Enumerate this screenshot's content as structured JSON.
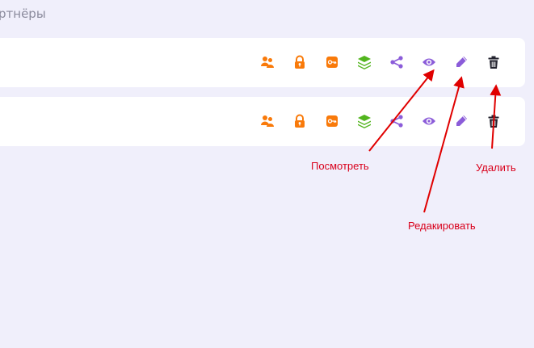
{
  "page": {
    "heading": "ртнёры"
  },
  "rows": [
    {
      "actions": [
        {
          "icon": "users-icon",
          "color": "#f97a0a"
        },
        {
          "icon": "lock-icon",
          "color": "#f97a0a"
        },
        {
          "icon": "key-icon",
          "color": "#f97a0a"
        },
        {
          "icon": "layers-icon",
          "color": "#52b51e"
        },
        {
          "icon": "share-icon",
          "color": "#8b5cd9"
        },
        {
          "icon": "eye-icon",
          "color": "#8b5cd9"
        },
        {
          "icon": "pencil-icon",
          "color": "#8b5cd9"
        },
        {
          "icon": "trash-icon",
          "color": "#23232f"
        }
      ]
    },
    {
      "actions": [
        {
          "icon": "users-icon",
          "color": "#f97a0a"
        },
        {
          "icon": "lock-icon",
          "color": "#f97a0a"
        },
        {
          "icon": "key-icon",
          "color": "#f97a0a"
        },
        {
          "icon": "layers-icon",
          "color": "#52b51e"
        },
        {
          "icon": "share-icon",
          "color": "#8b5cd9"
        },
        {
          "icon": "eye-icon",
          "color": "#8b5cd9"
        },
        {
          "icon": "pencil-icon",
          "color": "#8b5cd9"
        },
        {
          "icon": "trash-icon",
          "color": "#23232f"
        }
      ]
    }
  ],
  "annotations": {
    "view": "Посмотреть",
    "edit": "Редакировать",
    "delete": "Удалить",
    "color": "#d9001b"
  }
}
